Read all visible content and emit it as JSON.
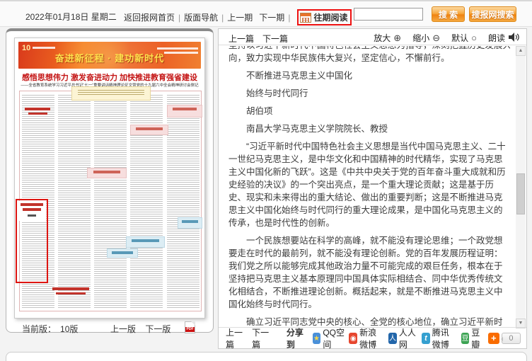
{
  "header": {
    "date": "2022年01月18日 星期二",
    "nav_home": "返回报网首页",
    "nav_layout": "版面导航",
    "nav_prev_issue": "上一期",
    "nav_next_issue": "下一期",
    "nav_archive": "往期阅读",
    "search_button": "搜 索",
    "site_search_button": "搜报网搜索"
  },
  "left_panel": {
    "masthead": {
      "page_badge": "10",
      "banner": "奋进新征程 · 建功新时代",
      "headline": "感悟思想伟力 激发奋进动力 加快推进教育强省建设",
      "subheadline": "——全省教育系统学习习近平总书记“七一”重要讲话精神理论征文暨党的十九届六中全会精神研讨会侧记"
    },
    "footer": {
      "current_label": "当前版：",
      "current_page": "10版",
      "prev_page": "上一版",
      "next_page": "下一版"
    }
  },
  "article_panel": {
    "toolbar": {
      "prev_article": "上一篇",
      "next_article": "下一篇",
      "zoom_in": "放大",
      "zoom_out": "缩小",
      "reset": "默认",
      "read_aloud": "朗读"
    },
    "content": {
      "clipped_line": "坚持以习近平新时代中国特色社会主义思想为指导，深刻把握历史发展大势和前进方",
      "lead_tail": "向，致力实现中华民族伟大复兴，坚定信心，不懈前行。",
      "title_line1": "不断推进马克思主义中国化",
      "title_line2": "始终与时代同行",
      "author": "胡伯项",
      "author_affiliation": "南昌大学马克思主义学院院长、教授",
      "paragraphs": [
        "“习近平新时代中国特色社会主义思想是当代中国马克思主义、二十一世纪马克思主义，是中华文化和中国精神的时代精华，实现了马克思主义中国化新的飞跃”。这是《中共中央关于党的百年奋斗重大成就和历史经验的决议》的一个突出亮点，是一个重大理论贡献；这是基于历史、现实和未来得出的重大结论、做出的重要判断；这是不断推进马克思主义中国化始终与时代同行的重大理论成果，是中国化马克思主义的传承，也是时代性的创新。",
        "一个民族想要站在科学的高峰，就不能没有理论思维；一个政党想要走在时代的最前列，就不能没有理论创新。党的百年发展历程证明：我们党之所以能够完成其他政治力量不可能完成的艰巨任务，根本在于坚持把马克思主义基本原理同中国具体实际相结合、同中华优秀传统文化相结合，不断推进理论创新。概括起来，就是不断推进马克思主义中国化始终与时代同行。",
        "确立习近平同志党中央的核心、全党的核心地位，确立习近平新时代中国特色社会主义思想的指导地位，对新时代党和国家事业发展、对推进中华民族伟大复兴历史"
      ]
    },
    "footer": {
      "prev_article": "上一篇",
      "next_article": "下一篇",
      "share_label": "分享到",
      "share_qzone": "QQ空间",
      "share_sina": "新浪微博",
      "share_renren": "人人网",
      "share_tqq": "腾讯微博",
      "share_douban": "豆瓣",
      "share_count": "0"
    }
  },
  "colors": {
    "accent_orange": "#ef8311",
    "annotation_red": "#ee1111",
    "masthead_red": "#e0391f",
    "headline_red": "#c41515"
  }
}
